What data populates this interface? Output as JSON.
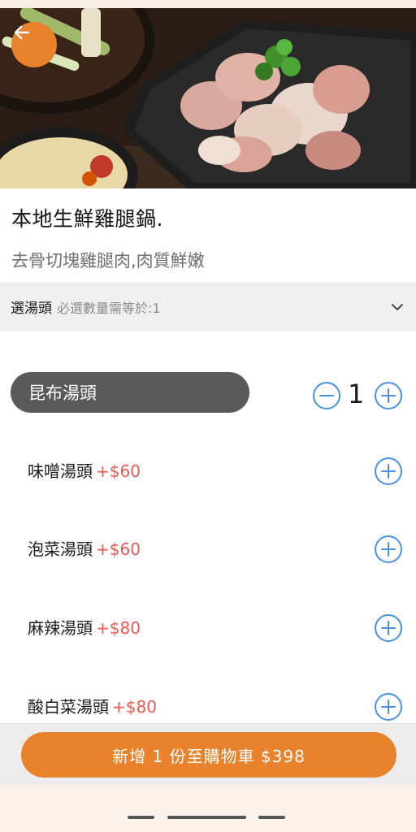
{
  "product": {
    "title": "本地生鮮雞腿鍋.",
    "description": "去骨切塊雞腿肉,肉質鮮嫩"
  },
  "section": {
    "title": "選湯頭",
    "hint": "必選數量需等於:1"
  },
  "selected_option": {
    "label": "昆布湯頭",
    "quantity": "1"
  },
  "options": [
    {
      "name": "味噌湯頭",
      "price": "+$60"
    },
    {
      "name": "泡菜湯頭",
      "price": "+$60"
    },
    {
      "name": "麻辣湯頭",
      "price": "+$80"
    },
    {
      "name": "酸白菜湯頭",
      "price": "+$80"
    }
  ],
  "cart_button": {
    "label": "新增 1 份至購物車 $398"
  },
  "colors": {
    "accent": "#e8822c",
    "price": "#e85a4f",
    "icon_blue": "#4a90e2",
    "pill": "#5a5a5a"
  },
  "icons": {
    "back": "arrow-left-icon",
    "chevron": "chevron-down-icon",
    "minus": "minus-circle-icon",
    "plus": "plus-circle-icon"
  }
}
